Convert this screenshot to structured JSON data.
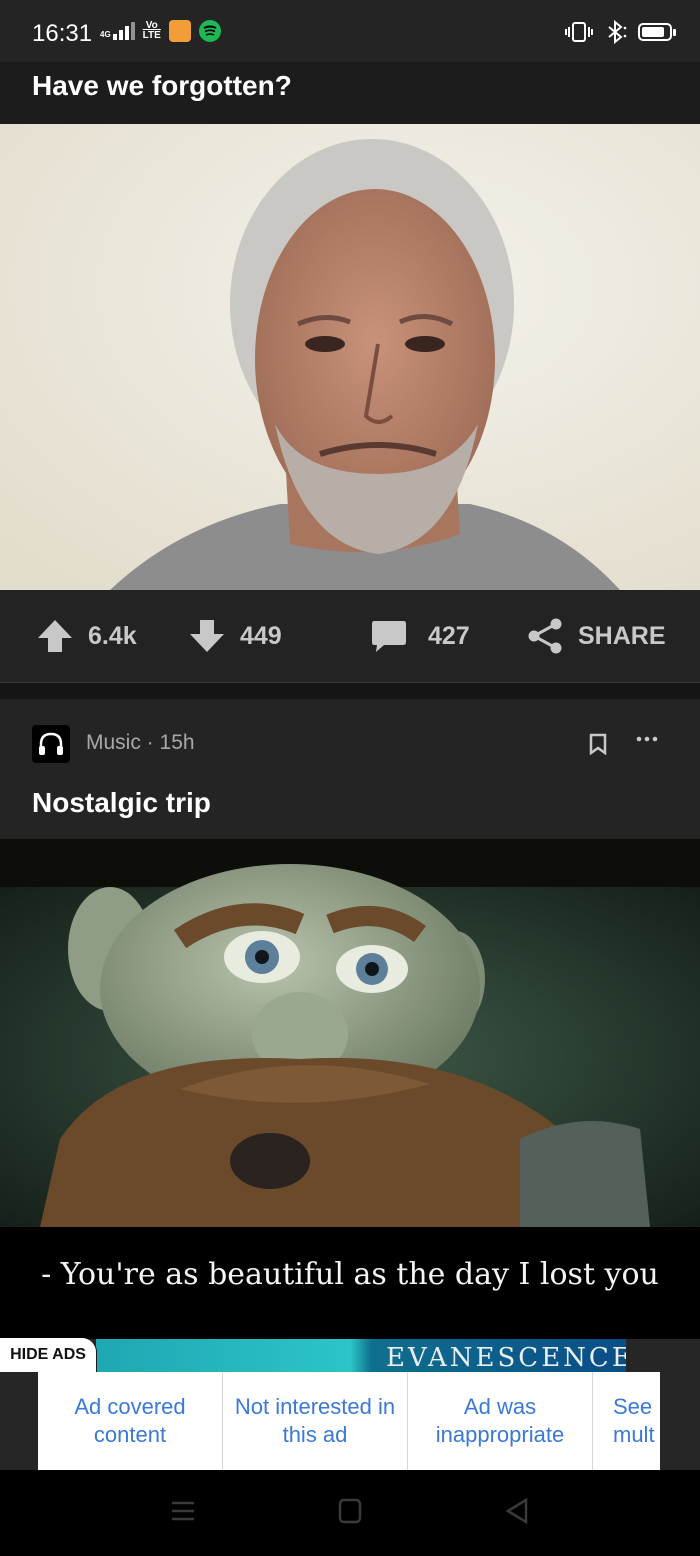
{
  "status_bar": {
    "time": "16:31",
    "network_label": "4G",
    "volte_label": "Vo",
    "lte_label": "LTE",
    "colors": {
      "app_icon": "#f29d38",
      "spotify": "#1db954"
    }
  },
  "post_1": {
    "title": "Have we forgotten?",
    "image_icon": "photo-portrait",
    "upvotes": "6.4k",
    "downvotes": "449",
    "comments": "427",
    "share_label": "SHARE"
  },
  "post_2": {
    "section": "Music",
    "time_ago": "15h",
    "title": "Nostalgic trip",
    "caption": "- You're as beautiful as the day I lost you"
  },
  "ads": {
    "hide_label": "HIDE ADS",
    "banner_text": "EVANESCENCE",
    "options": [
      {
        "label": "Ad covered content"
      },
      {
        "label": "Not interested in this ad"
      },
      {
        "label": "Ad was inappropriate"
      },
      {
        "label": "See mult"
      }
    ]
  },
  "nav_bar": {
    "icons": [
      "menu-icon",
      "home-icon",
      "back-icon"
    ]
  }
}
